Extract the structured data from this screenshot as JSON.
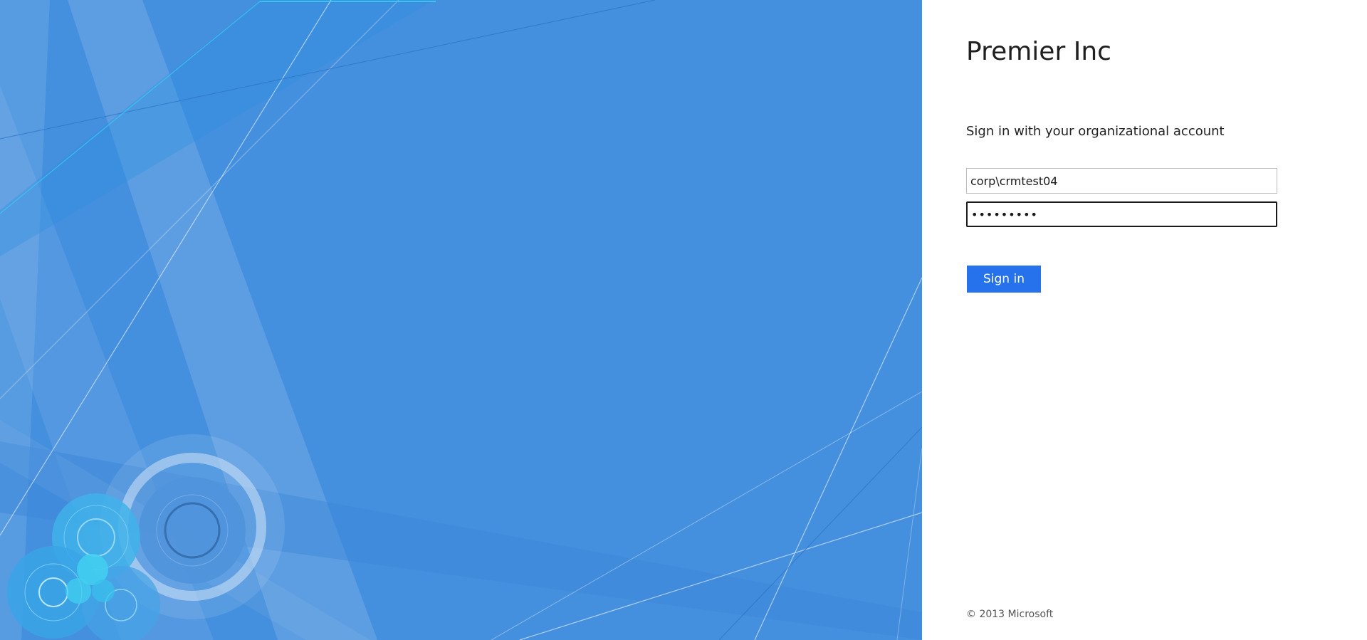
{
  "colors": {
    "illustration_background": "#4590de",
    "accent_button": "#2672ec",
    "panel_background": "#ffffff"
  },
  "branding": {
    "organization_name": "Premier Inc"
  },
  "form": {
    "heading": "Sign in with your organizational account",
    "username_value": "corp\\crmtest04",
    "password_value": "•••••••••",
    "submit_label": "Sign in"
  },
  "footer": {
    "copyright": "© 2013 Microsoft"
  }
}
